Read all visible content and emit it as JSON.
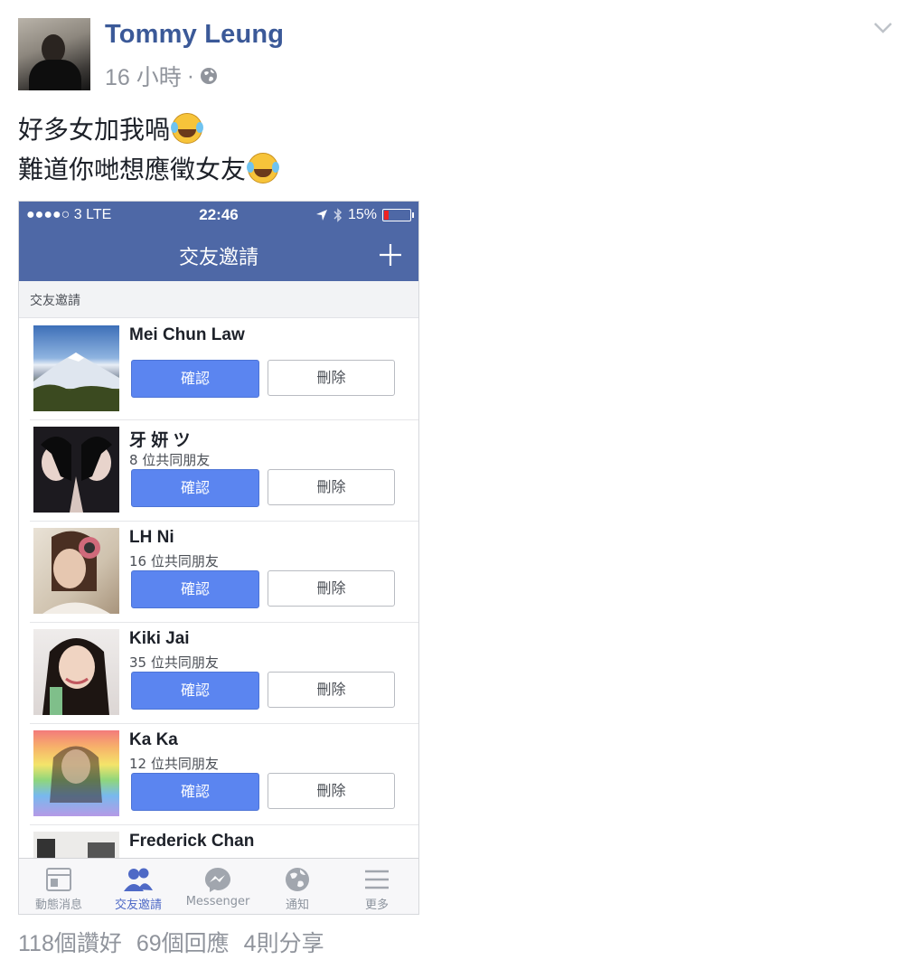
{
  "post": {
    "author": "Tommy Leung",
    "time": "16 小時",
    "separator": "·",
    "text_line1": "好多女加我喎",
    "text_line2": "難道你哋想應徵女友"
  },
  "phone": {
    "status": {
      "carrier": "●●●●○ 3 LTE",
      "time": "22:46",
      "battery": "15%"
    },
    "nav_title": "交友邀請",
    "section_header": "交友邀請",
    "requests": [
      {
        "name": "Mei Chun Law",
        "mutual": "",
        "confirm": "確認",
        "delete": "刪除"
      },
      {
        "name": "牙 妍 ツ",
        "mutual": "8 位共同朋友",
        "confirm": "確認",
        "delete": "刪除"
      },
      {
        "name": "LH Ni",
        "mutual": "16 位共同朋友",
        "confirm": "確認",
        "delete": "刪除"
      },
      {
        "name": "Kiki Jai",
        "mutual": "35 位共同朋友",
        "confirm": "確認",
        "delete": "刪除"
      },
      {
        "name": "Ka Ka",
        "mutual": "12 位共同朋友",
        "confirm": "確認",
        "delete": "刪除"
      },
      {
        "name": "Frederick Chan"
      }
    ],
    "tabs": [
      {
        "label": "動態消息",
        "icon": "news-feed-icon"
      },
      {
        "label": "交友邀請",
        "icon": "friends-icon",
        "active": true
      },
      {
        "label": "Messenger",
        "icon": "messenger-icon"
      },
      {
        "label": "通知",
        "icon": "globe-icon"
      },
      {
        "label": "更多",
        "icon": "menu-icon"
      }
    ]
  },
  "footer": {
    "likes": "118個讚好",
    "comments": "69個回應",
    "shares": "4則分享"
  },
  "colors": {
    "fb_blue": "#4e68a6",
    "link_blue": "#3b5998",
    "confirm_blue": "#5b85f0",
    "active_tab": "#4e69c6"
  }
}
